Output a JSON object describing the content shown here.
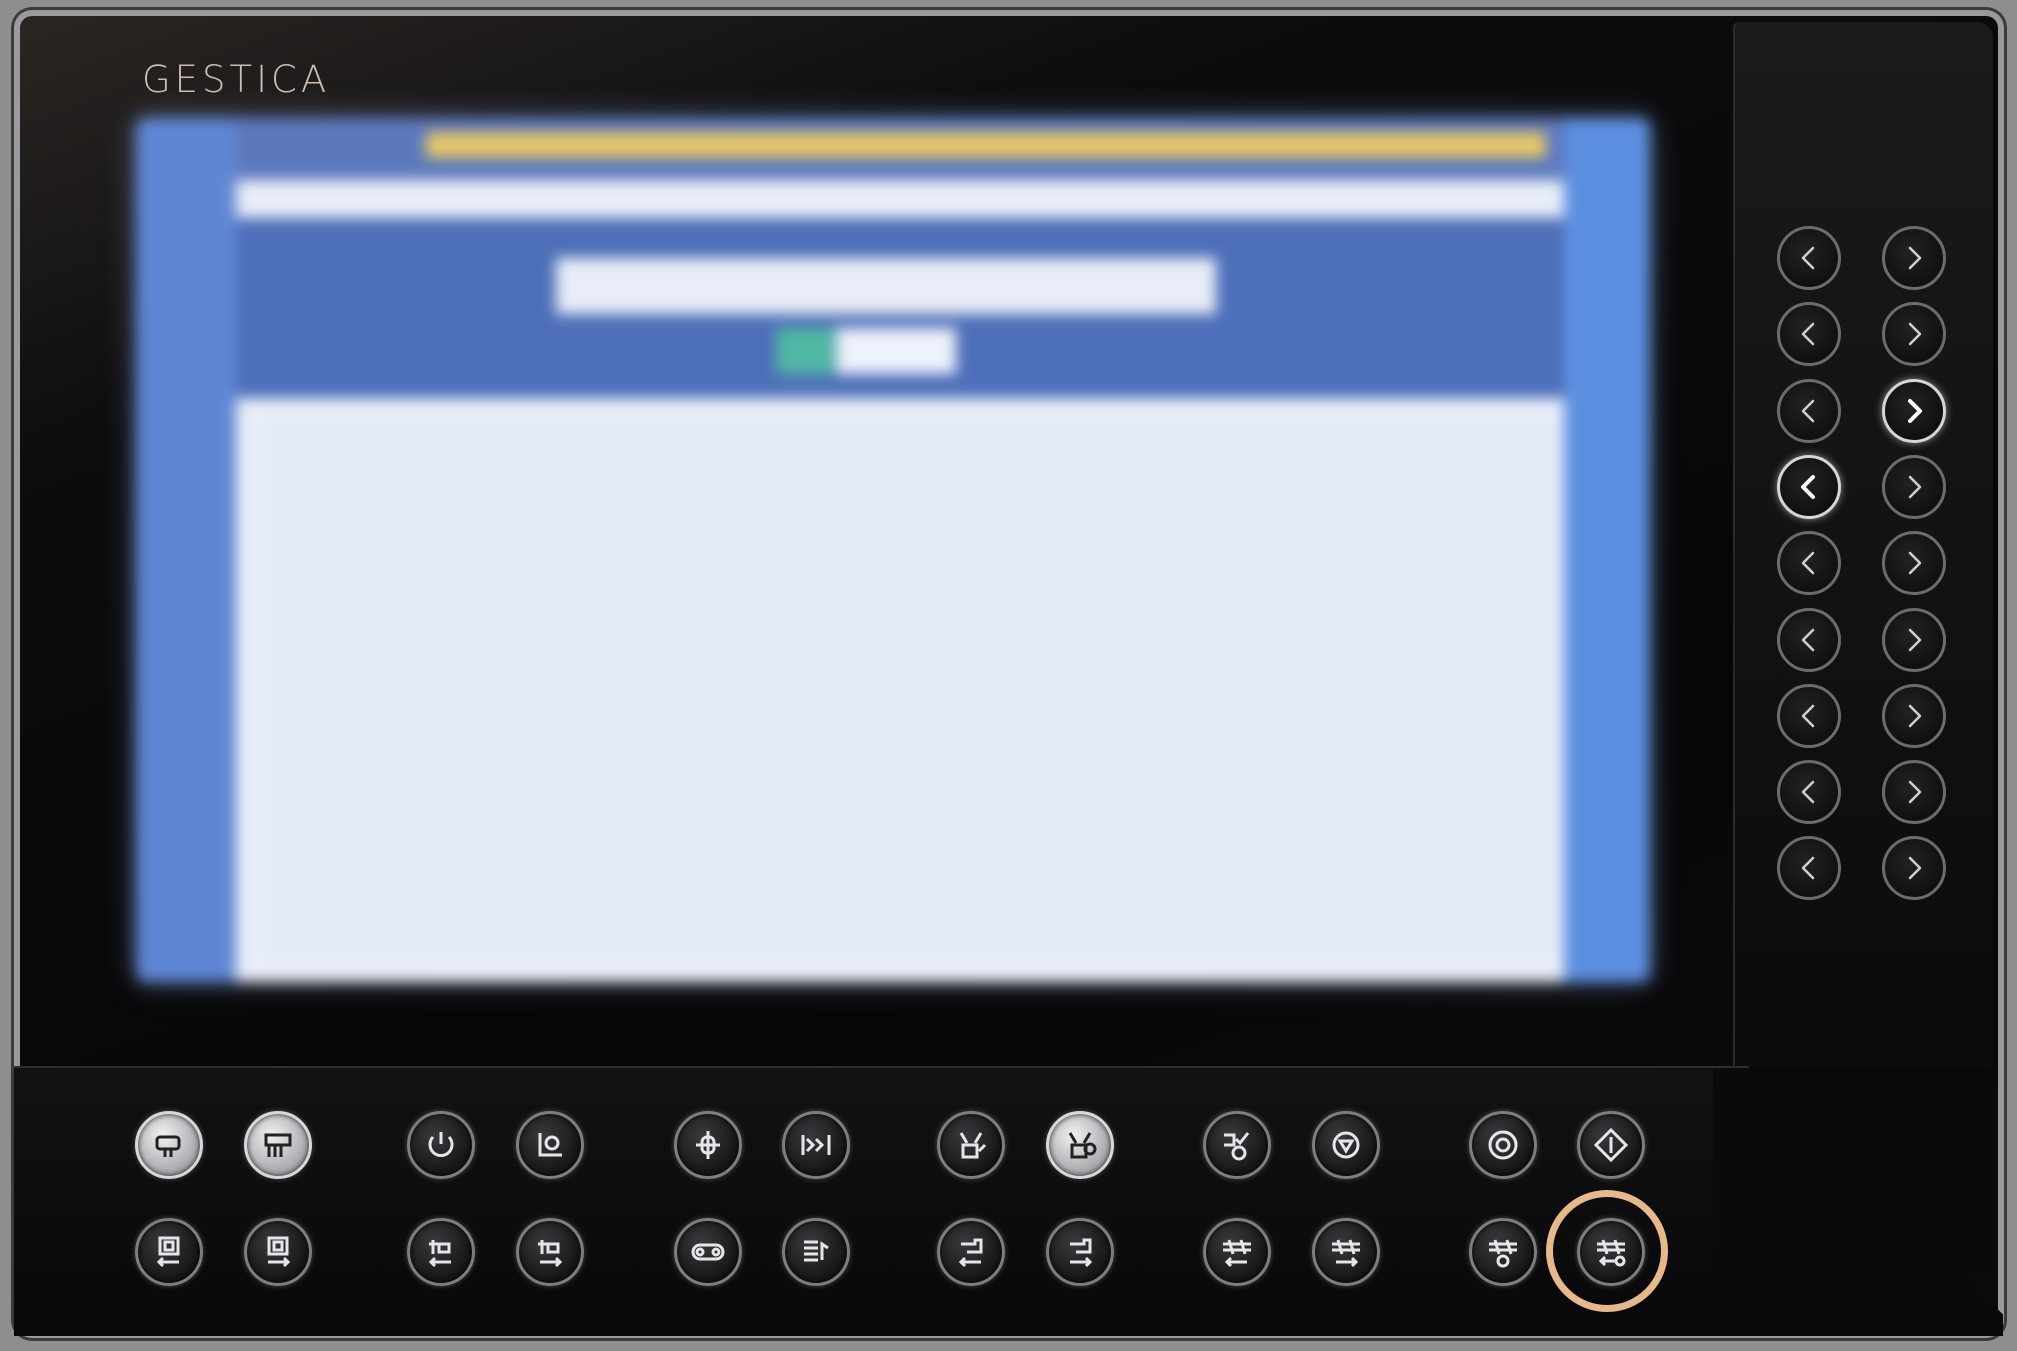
{
  "device": {
    "brand": "GESTICA"
  },
  "colors": {
    "highlight_ring": "#e7b88c",
    "screen_header": "#5d79bd",
    "screen_accent": "#e6c867"
  },
  "screen": {
    "state": "blurred"
  },
  "side_keys": {
    "rows": 9,
    "left_icon": "chevron-left-icon",
    "right_icon": "chevron-right-icon",
    "lit_keys": [
      "row-3-right",
      "row-4-left"
    ]
  },
  "bottom_keys": {
    "top_row": [
      "clamp-icon",
      "screw-unit-icon",
      "power-icon",
      "monitor-icon",
      "mold-adjust-icon",
      "step-forward-icon",
      "ejector-icon",
      "ejector-lit-icon",
      "core-pull-icon",
      "rotate-icon",
      "motor-icon",
      "start-icon"
    ],
    "bottom_row": [
      "mold-open-icon",
      "mold-close-icon",
      "carriage-back-icon",
      "carriage-forward-icon",
      "conveyor-icon",
      "program-icon",
      "injection-back-icon",
      "injection-forward-icon",
      "heater-back-icon",
      "heater-forward-icon",
      "heater-off-icon",
      "heater-return-icon"
    ],
    "highlighted": "heater-return-icon"
  }
}
